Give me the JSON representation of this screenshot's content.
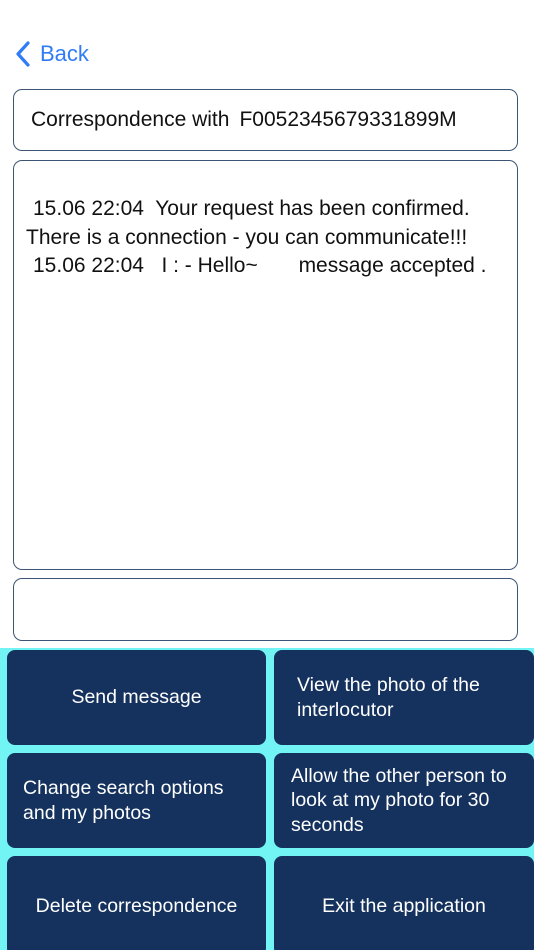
{
  "nav": {
    "back_label": "Back"
  },
  "header": {
    "prefix": "Correspondence with",
    "partner_id": "F0052345679331899M"
  },
  "messages": [
    "15.06 22:04  Your request has been confirmed.",
    "There is a connection - you can communicate!!!",
    "15.06 22:04   I : - Hello~       message accepted ."
  ],
  "input": {
    "value": "",
    "placeholder": ""
  },
  "buttons": {
    "send": "Send message",
    "view_photo": "View the photo of the interlocutor",
    "change_search": "Change search options and my photos",
    "allow_photo": "Allow the other person to look at my photo for 30 seconds",
    "delete": "Delete correspondence",
    "exit": "Exit the application"
  },
  "colors": {
    "accent": "#2f7cf6",
    "button_bg": "#15325e",
    "panel_bg": "#73f4f4",
    "border": "#3d5575"
  }
}
